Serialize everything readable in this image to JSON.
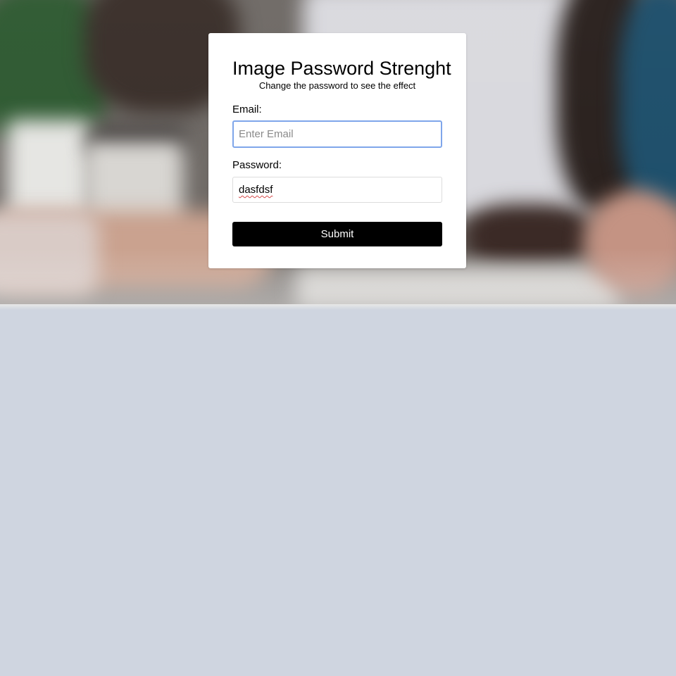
{
  "form": {
    "title": "Image Password Strenght",
    "subtitle": "Change the password to see the effect",
    "email_label": "Email:",
    "email_placeholder": "Enter Email",
    "email_value": "",
    "password_label": "Password:",
    "password_value": "dasfdsf",
    "submit_label": "Submit"
  },
  "colors": {
    "page_background": "#cfd5e0",
    "card_background": "#ffffff",
    "button_background": "#000000",
    "button_text": "#ffffff",
    "focus_ring": "#7fa6ea"
  }
}
